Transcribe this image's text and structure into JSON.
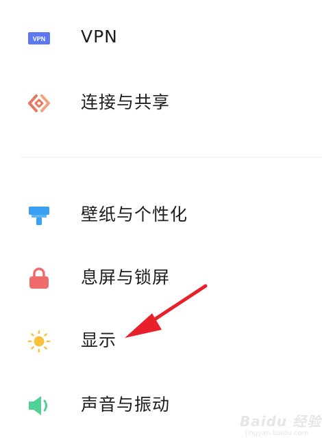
{
  "settings": {
    "items": [
      {
        "label": "VPN",
        "icon": "vpn-icon",
        "icon_text": "VPN",
        "color": "#5b78f0"
      },
      {
        "label": "连接与共享",
        "icon": "connection-sharing-icon",
        "color": "#e8775e"
      },
      {
        "label": "壁纸与个性化",
        "icon": "wallpaper-icon",
        "color": "#3aa1f2"
      },
      {
        "label": "息屏与锁屏",
        "icon": "lock-icon",
        "color": "#ef6c6c"
      },
      {
        "label": "显示",
        "icon": "brightness-icon",
        "color": "#f7c23b"
      },
      {
        "label": "声音与振动",
        "icon": "speaker-icon",
        "color": "#4fd198"
      }
    ]
  },
  "annotation": {
    "color": "#e8202a"
  },
  "watermark": {
    "brand": "Baidu 经验",
    "url": "jingyan.baidu.com"
  }
}
